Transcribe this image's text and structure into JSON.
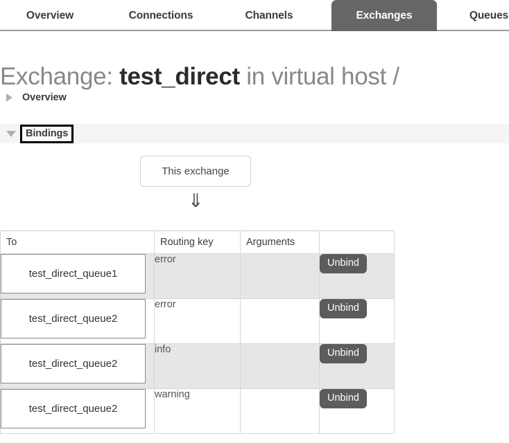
{
  "nav": {
    "tabs": [
      {
        "id": "overview",
        "label": "Overview",
        "active": false
      },
      {
        "id": "connections",
        "label": "Connections",
        "active": false
      },
      {
        "id": "channels",
        "label": "Channels",
        "active": false
      },
      {
        "id": "exchanges",
        "label": "Exchanges",
        "active": true
      },
      {
        "id": "queues",
        "label": "Queues",
        "active": false
      }
    ]
  },
  "page": {
    "title_prefix": "Exchange:",
    "title_name": "test_direct",
    "title_suffix": "in virtual host /"
  },
  "sections": {
    "overview": {
      "label": "Overview",
      "expanded": false,
      "toggle_icon": "triangle-right-icon"
    },
    "bindings": {
      "label": "Bindings",
      "expanded": true,
      "toggle_icon": "triangle-down-icon",
      "focused": true
    }
  },
  "diagram": {
    "node_label": "This exchange",
    "arrow_glyph": "⇓"
  },
  "bindings_table": {
    "columns": [
      "To",
      "Routing key",
      "Arguments",
      ""
    ],
    "rows": [
      {
        "to": "test_direct_queue1",
        "routing_key": "error",
        "arguments": "",
        "action": "Unbind",
        "shaded": true
      },
      {
        "to": "test_direct_queue2",
        "routing_key": "error",
        "arguments": "",
        "action": "Unbind",
        "shaded": false
      },
      {
        "to": "test_direct_queue2",
        "routing_key": "info",
        "arguments": "",
        "action": "Unbind",
        "shaded": true
      },
      {
        "to": "test_direct_queue2",
        "routing_key": "warning",
        "arguments": "",
        "action": "Unbind",
        "shaded": false
      }
    ]
  },
  "colors": {
    "active_tab_bg": "#666666",
    "unbind_button_bg": "#5c5c5c",
    "section_band_bg": "#f5f5f5",
    "row_shade_bg": "#e6e6e6",
    "title_muted": "#888888"
  }
}
